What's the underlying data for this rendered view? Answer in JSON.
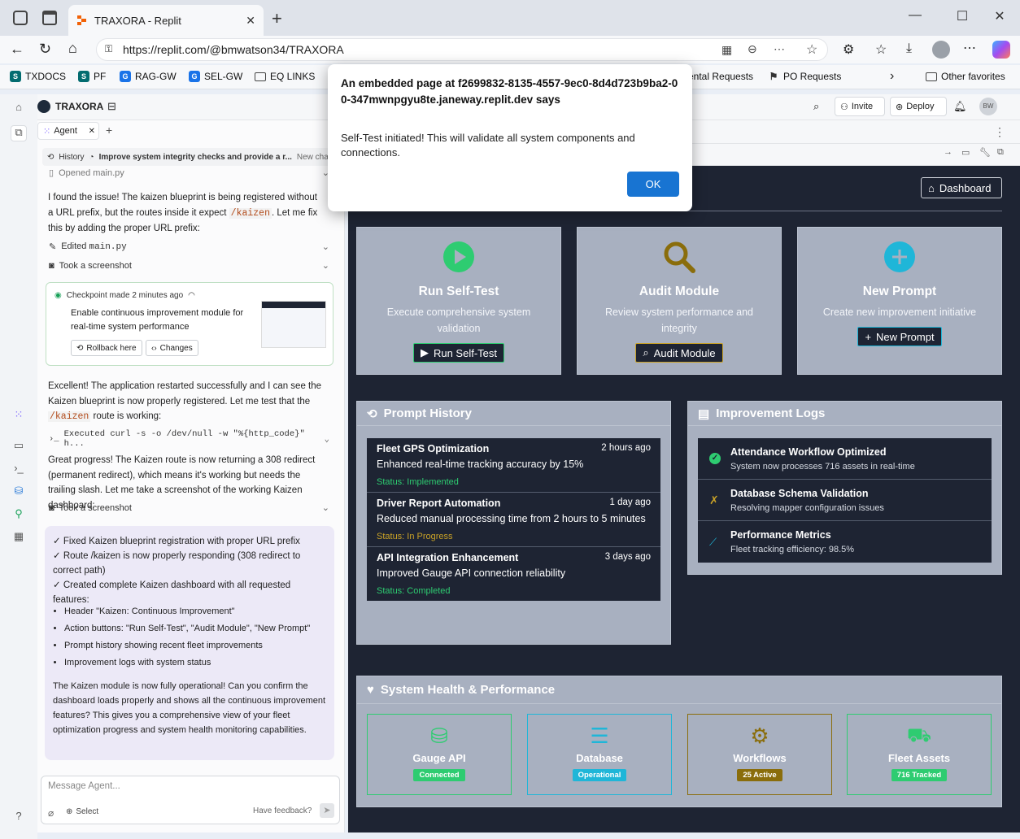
{
  "browser": {
    "tab_title": "TRAXORA - Replit",
    "url_prefix": "https://",
    "url_domain": "replit.com",
    "url_path": "/@bmwatson34/TRAXORA",
    "favorites": [
      "TXDOCS",
      "PF",
      "RAG-GW",
      "SEL-GW",
      "EQ LINKS",
      "ental Requests",
      "PO Requests",
      "Other favorites"
    ]
  },
  "replit": {
    "project_name": "TRAXORA",
    "invite_label": "Invite",
    "deploy_label": "Deploy",
    "avatar_initials": "BW",
    "agent_tab": "Agent",
    "history_label": "History",
    "history_title": "Improve system integrity checks and provide a r...",
    "new_chat": "New cha"
  },
  "agent": {
    "opened_file": "Opened main.py",
    "msg1_a": "I found the issue! The kaizen blueprint is being registered without a URL prefix, but the routes inside it expect ",
    "msg1_code": "/kaizen",
    "msg1_b": ". Let me fix this by adding the proper URL prefix:",
    "edited_prefix": "Edited ",
    "edited_file": "main.py",
    "screenshot1": "Took a screenshot",
    "checkpoint_label": "Checkpoint made 2 minutes ago",
    "checkpoint_text": "Enable continuous improvement module for real-time system performance",
    "rollback_label": "Rollback here",
    "changes_label": "Changes",
    "msg2_a": "Excellent! The application restarted successfully and I can see the Kaizen blueprint is now properly registered. Let me test that the ",
    "msg2_code": "/kaizen",
    "msg2_b": " route is working:",
    "executed": "Executed curl -s -o /dev/null -w \"%{http_code}\" h...",
    "msg3": "Great progress! The Kaizen route is now returning a 308 redirect (permanent redirect), which means it's working but needs the trailing slash. Let me take a screenshot of the working Kaizen dashboard:",
    "screenshot2": "Took a screenshot",
    "summary_checks": [
      "✓ Fixed Kaizen blueprint registration with proper URL prefix",
      "✓ Route /kaizen is now properly responding (308 redirect to correct path)",
      "✓ Created complete Kaizen dashboard with all requested features:"
    ],
    "summary_bullets": [
      "Header \"Kaizen: Continuous Improvement\"",
      "Action buttons: \"Run Self-Test\", \"Audit Module\", \"New Prompt\"",
      "Prompt history showing recent fleet improvements",
      "Improvement logs with system status"
    ],
    "summary_closing": "The Kaizen module is now fully operational! Can you confirm the dashboard loads properly and shows all the continuous improvement features? This gives you a comprehensive view of your fleet optimization progress and system health monitoring capabilities.",
    "message_placeholder": "Message Agent...",
    "select_label": "Select",
    "feedback_label": "Have feedback?"
  },
  "dashboard": {
    "dashboard_button": "Dashboard",
    "cards": [
      {
        "title": "Run Self-Test",
        "desc": "Execute comprehensive system validation",
        "button": "Run Self-Test",
        "color": "#2ecc71"
      },
      {
        "title": "Audit Module",
        "desc": "Review system performance and integrity",
        "button": "Audit Module",
        "color": "#8a6d0b"
      },
      {
        "title": "New Prompt",
        "desc": "Create new improvement initiative",
        "button": "New Prompt",
        "color": "#1fb6d8"
      }
    ],
    "prompt_history_title": "Prompt History",
    "history_items": [
      {
        "title": "Fleet GPS Optimization",
        "time": "2 hours ago",
        "desc": "Enhanced real-time tracking accuracy by 15%",
        "status": "Status: Implemented",
        "status_color": "#2ecc71"
      },
      {
        "title": "Driver Report Automation",
        "time": "1 day ago",
        "desc": "Reduced manual processing time from 2 hours to 5 minutes",
        "status": "Status: In Progress",
        "status_color": "#c9a227"
      },
      {
        "title": "API Integration Enhancement",
        "time": "3 days ago",
        "desc": "Improved Gauge API connection reliability",
        "status": "Status: Completed",
        "status_color": "#2ecc71"
      }
    ],
    "improvement_logs_title": "Improvement Logs",
    "logs": [
      {
        "title": "Attendance Workflow Optimized",
        "desc": "System now processes 716 assets in real-time",
        "icon": "check-circle-icon"
      },
      {
        "title": "Database Schema Validation",
        "desc": "Resolving mapper configuration issues",
        "icon": "tools-icon"
      },
      {
        "title": "Performance Metrics",
        "desc": "Fleet tracking efficiency: 98.5%",
        "icon": "chart-line-icon"
      }
    ],
    "health_title": "System Health & Performance",
    "health": [
      {
        "name": "Gauge API",
        "badge": "Connected",
        "color": "#2ecc71"
      },
      {
        "name": "Database",
        "badge": "Operational",
        "color": "#1fb6d8"
      },
      {
        "name": "Workflows",
        "badge": "25 Active",
        "color": "#8a6d0b"
      },
      {
        "name": "Fleet Assets",
        "badge": "716 Tracked",
        "color": "#2ecc71"
      }
    ]
  },
  "dialog": {
    "title": "An embedded page at f2699832-8135-4557-9ec0-8d4d723b9ba2-00-347mwnpgyu8te.janeway.replit.dev says",
    "message": "Self-Test initiated! This will validate all system components and connections.",
    "ok_label": "OK"
  }
}
